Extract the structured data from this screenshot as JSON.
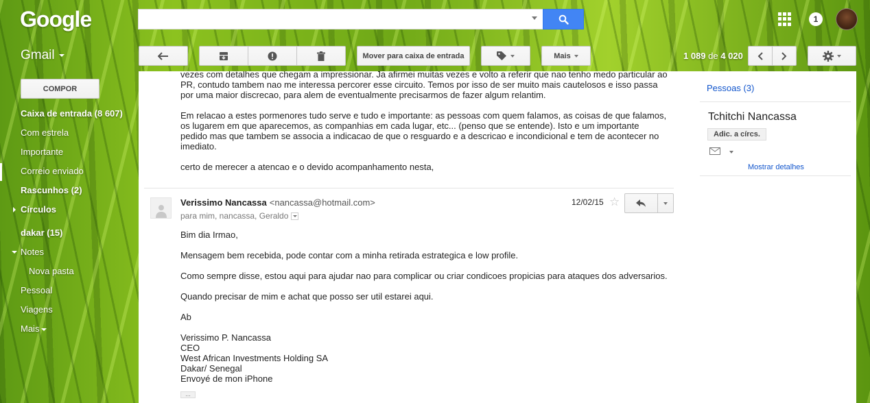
{
  "header": {
    "logo": "Google",
    "search_placeholder": "",
    "notification_count": "1",
    "icons": {
      "search": "search-icon",
      "apps": "apps-grid-icon",
      "avatar": "account-avatar"
    }
  },
  "toolbar": {
    "app_label": "Gmail",
    "move_to_inbox": "Mover para caixa de entrada",
    "more": "Mais",
    "pager": {
      "range": "1 089",
      "of_word": "de",
      "total": "4 020"
    },
    "icons": [
      "back-arrow-icon",
      "archive-icon",
      "report-spam-icon",
      "trash-icon",
      "label-icon",
      "older-chevron-icon",
      "newer-chevron-icon",
      "settings-gear-icon"
    ]
  },
  "sidebar": {
    "compose": "COMPOR",
    "items": [
      {
        "label": "Caixa de entrada (8 607)"
      },
      {
        "label": "Com estrela"
      },
      {
        "label": "Importante"
      },
      {
        "label": "Correio enviado"
      },
      {
        "label": "Rascunhos (2)"
      },
      {
        "label": "Círculos"
      },
      {
        "label": "dakar (15)"
      },
      {
        "label": "Notes"
      },
      {
        "label": "Nova pasta"
      },
      {
        "label": "Pessoal"
      },
      {
        "label": "Viagens"
      },
      {
        "label": "Mais"
      }
    ]
  },
  "thread": {
    "prev_message": {
      "lines": [
        "vezes com detalhes que chegam a impressionar. Ja afirmei muitas vezes e volto a referir que nao tenho medo particular ao",
        "PR, contudo tambem nao me interessa percorer esse circuito. Temos por isso de ser muito mais cautelosos e isso passa",
        "por uma maior discrecao, para alem de eventualmente precisarmos de fazer algum relantim.",
        "Em relacao a estes pormenores tudo serve e tudo e importante: as pessoas com quem falamos, as coisas de que falamos,",
        "os lugarem em que aparecemos, as companhias em cada lugar, etc... (penso que se entende). Isto e um importante",
        "pedido mas que tambem se associa a indicacao de que o resguardo e a descricao e incondicional e tem de acontecer no",
        "imediato.",
        "certo de merecer a atencao e o devido acompanhamento nesta,"
      ]
    },
    "message": {
      "sender_name": "Verissimo Nancassa",
      "sender_email": "<nancassa@hotmail.com>",
      "recipients": "para mim, nancassa, Geraldo",
      "date": "12/02/15",
      "body": [
        "Bim dia Irmao,",
        "Mensagem bem recebida, pode contar com a minha retirada estrategica e low profile.",
        "Como sempre disse, estou aqui para ajudar nao para complicar ou criar condicoes propicias para ataques dos adversarios.",
        "Quando precisar de mim e achat que posso ser util estarei aqui.",
        "Ab"
      ],
      "signature": [
        "Verissimo P. Nancassa",
        "CEO",
        "West African Investments Holding SA",
        "Dakar/ Senegal",
        "Envoyé de mon iPhone"
      ],
      "trimmed": "..."
    }
  },
  "people_panel": {
    "header": "Pessoas (3)",
    "contact_name": "Tchitchi Nancassa",
    "add_to_circles": "Adic. a círcs.",
    "show_details": "Mostrar detalhes"
  },
  "colors": {
    "accent_blue": "#4285f4",
    "link": "#1155cc",
    "background_theme": "#7fb81d"
  }
}
